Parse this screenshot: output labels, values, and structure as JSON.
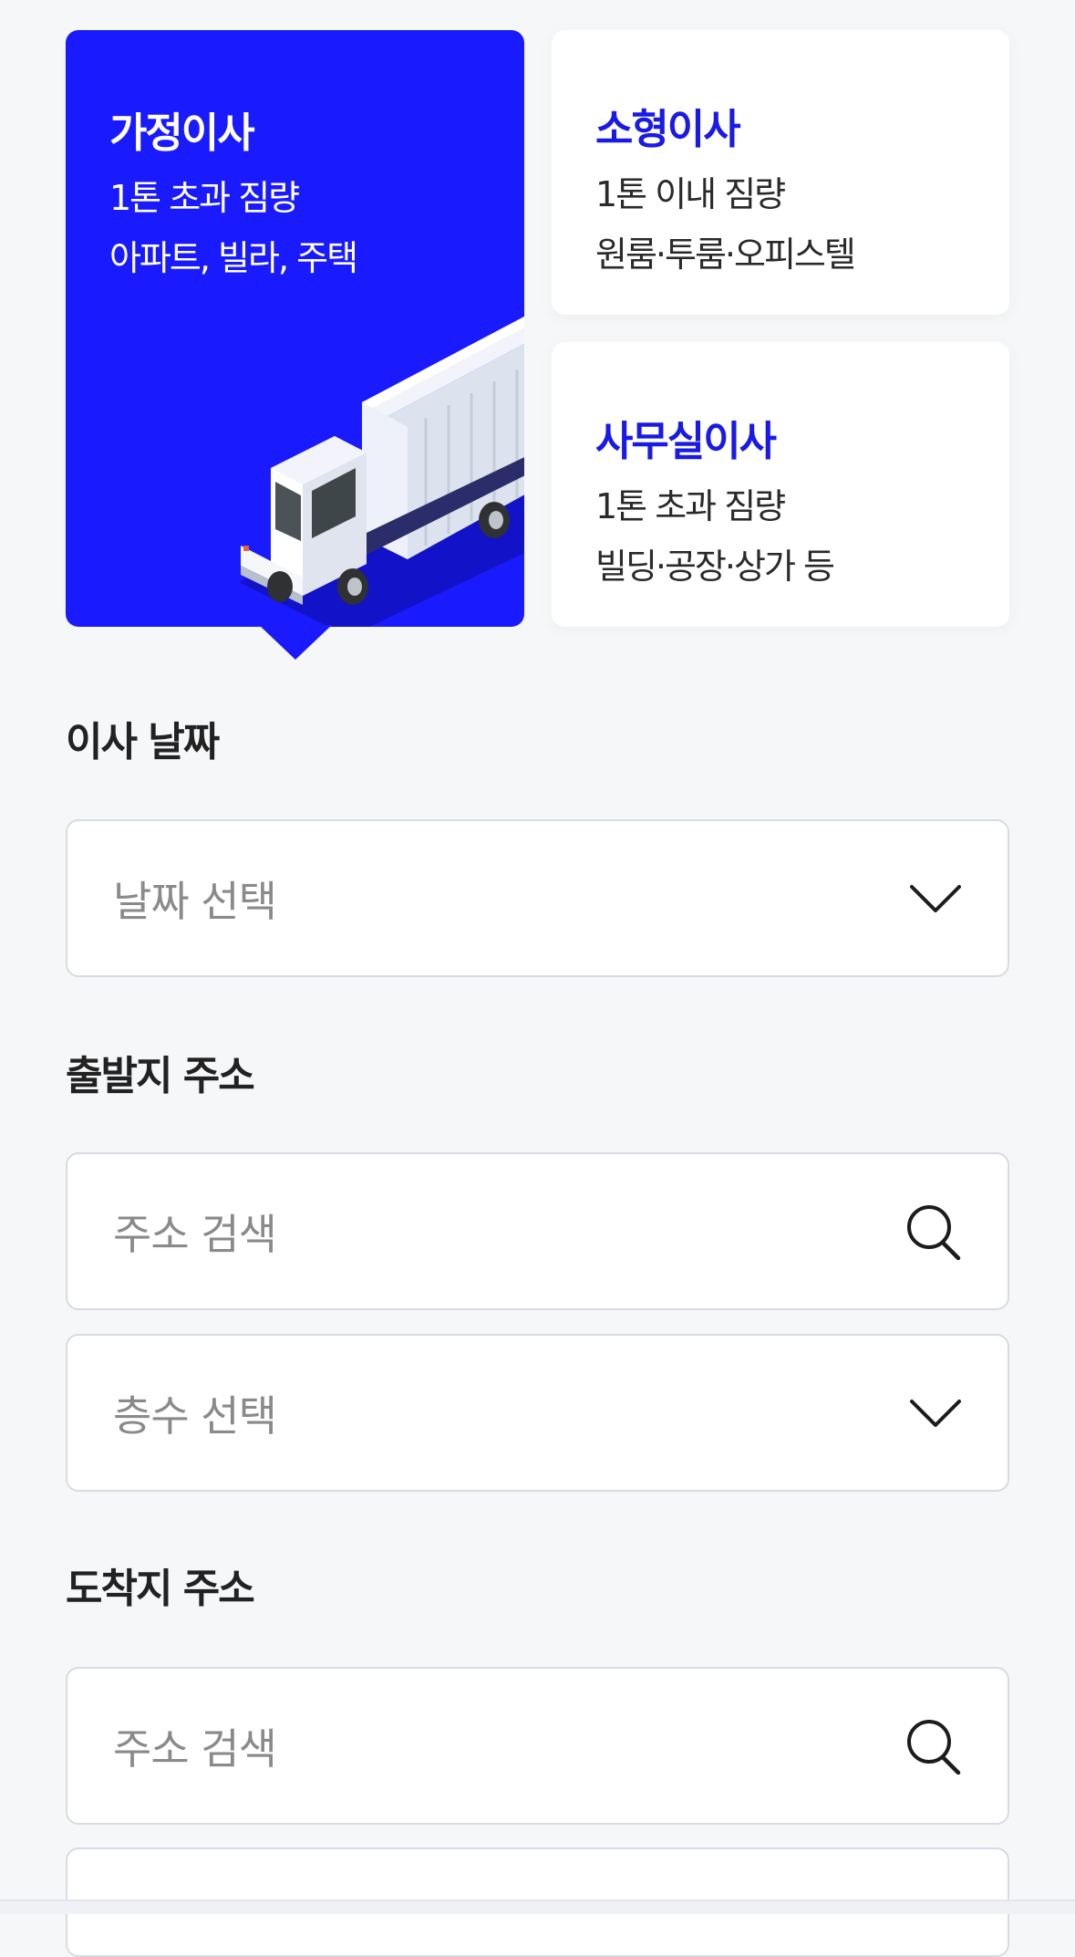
{
  "move_types": [
    {
      "title": "가정이사",
      "line1": "1톤 초과 짐량",
      "line2": "아파트, 빌라, 주택",
      "selected": true
    },
    {
      "title": "소형이사",
      "line1": "1톤 이내 짐량",
      "line2": "원룸·투룸·오피스텔",
      "selected": false
    },
    {
      "title": "사무실이사",
      "line1": "1톤 초과 짐량",
      "line2": "빌딩·공장·상가 등",
      "selected": false
    }
  ],
  "move_date": {
    "label": "이사 날짜",
    "placeholder": "날짜 선택",
    "icon": "chevron-down-icon"
  },
  "departure": {
    "label": "출발지 주소",
    "address_placeholder": "주소 검색",
    "address_icon": "search-icon",
    "floor_placeholder": "층수 선택",
    "floor_icon": "chevron-down-icon"
  },
  "arrival": {
    "label": "도착지 주소",
    "address_placeholder": "주소 검색",
    "address_icon": "search-icon"
  },
  "colors": {
    "accent": "#1a1aff",
    "accent_text": "#1a1ae6",
    "background": "#f6f7f9"
  }
}
